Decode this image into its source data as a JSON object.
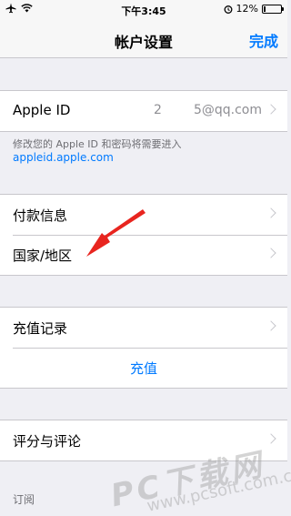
{
  "status_bar": {
    "time": "下午3:45",
    "battery": "12%",
    "battery_level": 0.12
  },
  "nav": {
    "title": "帐户设置",
    "done": "完成"
  },
  "apple_id": {
    "label": "Apple ID",
    "value": "2     5@qq.com",
    "footer_text": "修改您的 Apple ID 和密码将需要进入",
    "footer_link": "appleid.apple.com"
  },
  "group2": {
    "payment": "付款信息",
    "country": "国家/地区"
  },
  "group3": {
    "purchase_history": "充值记录",
    "top_up": "充值"
  },
  "group4": {
    "ratings": "评分与评论"
  },
  "subscriptions": {
    "header": "订阅"
  },
  "watermark": {
    "brand": "PC下载网",
    "url": "www.pcsoft.com.cn"
  }
}
